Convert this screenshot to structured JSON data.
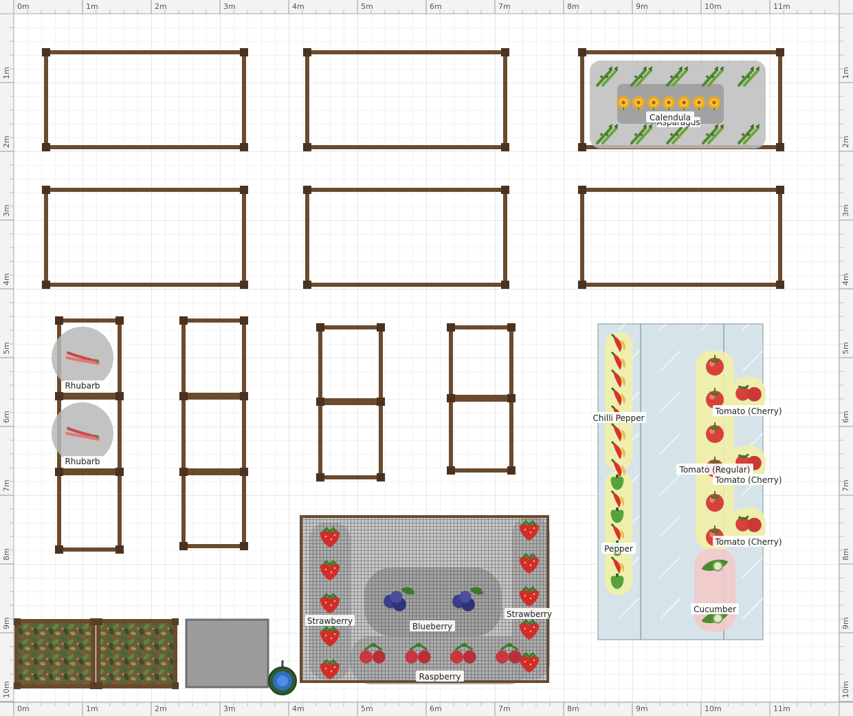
{
  "ruler": {
    "unit": "m",
    "horizontal_labels": [
      "0m",
      "1m",
      "2m",
      "3m",
      "4m",
      "5m",
      "6m",
      "7m",
      "8m",
      "9m",
      "10m",
      "11m"
    ],
    "vertical_labels": [
      "1m",
      "2m",
      "3m",
      "4m",
      "5m",
      "6m",
      "7m",
      "8m",
      "9m",
      "10m"
    ]
  },
  "colors": {
    "wood": "#6b4a2e",
    "wood_dark": "#4b3220",
    "grid": "#e3e3e3",
    "grid_major": "#c9c9c9",
    "ruler_bg": "#f3f3f3",
    "greenhouse": "#d7e6ea",
    "plant_zone_yellow": "#f4f0a8",
    "plant_zone_gray": "#9a9a9a",
    "plant_zone_red": "#f3c8c8",
    "net": "#555555"
  },
  "plants": {
    "calendula": "Calendula",
    "asparagus": "Asparagus",
    "rhubarb_1": "Rhubarb",
    "rhubarb_2": "Rhubarb",
    "chilli_pepper": "Chilli Pepper",
    "pepper": "Pepper",
    "tomato_cherry_1": "Tomato (Cherry)",
    "tomato_regular": "Tomato (Regular)",
    "tomato_cherry_2": "Tomato (Cherry)",
    "tomato_cherry_3": "Tomato (Cherry)",
    "cucumber": "Cucumber",
    "strawberry_left": "Strawberry",
    "strawberry_right": "Strawberry",
    "blueberry": "Blueberry",
    "raspberry": "Raspberry"
  },
  "icons": {
    "asparagus": "asparagus-icon",
    "calendula": "calendula-flower-icon",
    "rhubarb": "rhubarb-icon",
    "chilli": "chilli-pepper-icon",
    "pepper": "bell-pepper-icon",
    "tomato": "tomato-icon",
    "cucumber": "cucumber-icon",
    "strawberry": "strawberry-icon",
    "blueberry": "blueberry-icon",
    "raspberry": "raspberry-icon",
    "water_butt": "water-butt-icon"
  }
}
